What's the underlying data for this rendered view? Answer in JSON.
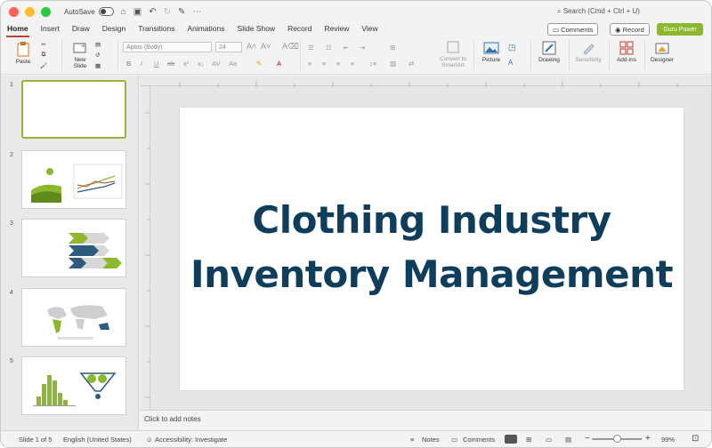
{
  "titlebar": {
    "autosave_label": "AutoSave",
    "search_placeholder": "Search (Cmd + Ctrl + U)"
  },
  "tabs": [
    "Home",
    "Insert",
    "Draw",
    "Design",
    "Transitions",
    "Animations",
    "Slide Show",
    "Record",
    "Review",
    "View"
  ],
  "actions": {
    "comments": "Comments",
    "record": "Record",
    "guru": "Guru Power"
  },
  "ribbon": {
    "paste": "Paste",
    "new_slide_l1": "New",
    "new_slide_l2": "Slide",
    "font_name": "Aptos (Body)",
    "font_size": "24",
    "convert_l1": "Convert to",
    "convert_l2": "SmartArt",
    "picture": "Picture",
    "drawing": "Drawing",
    "sensitivity": "Sensitivity",
    "addins": "Add-ins",
    "designer": "Designer"
  },
  "slide": {
    "title_line1": "Clothing Industry",
    "title_line2": "Inventory Management"
  },
  "thumbnails": [
    "1",
    "2",
    "3",
    "4",
    "5"
  ],
  "notes_placeholder": "Click to add notes",
  "status": {
    "slide_info": "Slide 1 of 5",
    "language": "English (United States)",
    "accessibility": "Accessibility: Investigate",
    "notes": "Notes",
    "comments": "Comments",
    "zoom": "99%"
  },
  "colors": {
    "accent": "#b7472a",
    "guru": "#8cb72f",
    "title": "#0f3d5c",
    "thumb_green": "#8cb72f",
    "thumb_blue": "#2d5c7f"
  }
}
